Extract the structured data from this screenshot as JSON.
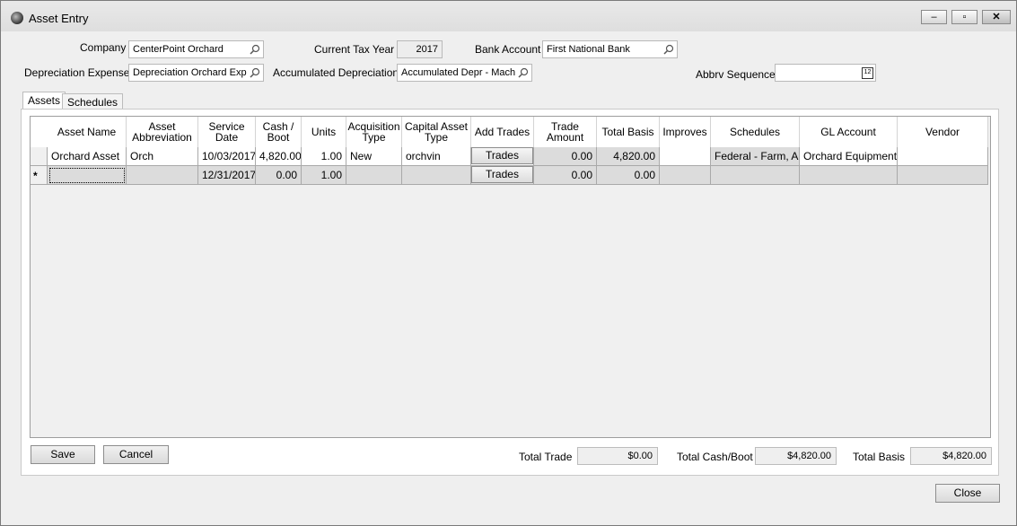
{
  "window": {
    "title": "Asset Entry",
    "minimize": "–",
    "restore": "▫",
    "close": "✕"
  },
  "form": {
    "company_label": "Company",
    "company_value": "CenterPoint Orchard",
    "tax_year_label": "Current Tax Year",
    "tax_year_value": "2017",
    "bank_label": "Bank Account",
    "bank_value": "First National Bank",
    "dep_expense_label": "Depreciation Expense",
    "dep_expense_value": "Depreciation Orchard Expe",
    "accum_dep_label": "Accumulated Depreciation",
    "accum_dep_value": "Accumulated Depr - Machi",
    "abbrv_label": "Abbrv Sequence",
    "abbrv_value": ""
  },
  "tabs": [
    "Assets",
    "Schedules"
  ],
  "grid": {
    "headers": [
      "Asset Name",
      "Asset Abbreviation",
      "Service Date",
      "Cash / Boot",
      "Units",
      "Acquisition Type",
      "Capital Asset Type",
      "Add Trades",
      "Trade Amount",
      "Total Basis",
      "Improves",
      "Schedules",
      "GL Account",
      "Vendor"
    ],
    "rows": [
      [
        "Orchard Asset",
        "Orch",
        "10/03/2017",
        "4,820.00",
        "1.00",
        "New",
        "orchvin",
        "Trades",
        "0.00",
        "4,820.00",
        "",
        "Federal - Farm, A",
        "Orchard Equipment",
        ""
      ],
      [
        "",
        "",
        "12/31/2017",
        "0.00",
        "1.00",
        "",
        "",
        "Trades",
        "0.00",
        "0.00",
        "",
        "",
        "",
        ""
      ]
    ],
    "new_row_marker": "*"
  },
  "buttons": {
    "save": "Save",
    "cancel": "Cancel",
    "close": "Close"
  },
  "totals": {
    "trade_label": "Total Trade",
    "trade_value": "$0.00",
    "cash_label": "Total Cash/Boot",
    "cash_value": "$4,820.00",
    "basis_label": "Total Basis",
    "basis_value": "$4,820.00"
  },
  "icons": {
    "lookup": "magnifier-icon",
    "calendar": "calendar-icon"
  }
}
